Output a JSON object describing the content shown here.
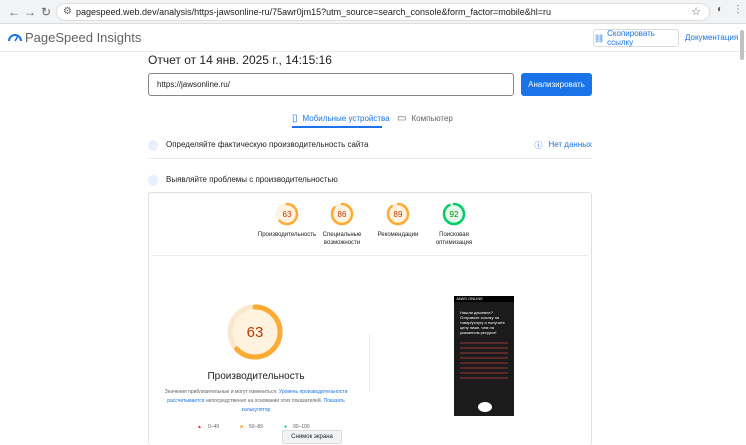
{
  "browser": {
    "url": "pagespeed.web.dev/analysis/https-jawsonline-ru/75awr0jm15?utm_source=search_console&form_factor=mobile&hl=ru"
  },
  "header": {
    "brand": "PageSpeed Insights",
    "copy_link": "Скопировать ссылку",
    "docs": "Документация"
  },
  "report": {
    "title": "Отчет от 14 янв. 2025 г., 14:15:16",
    "input_value": "https://jawsonline.ru/",
    "analyze_label": "Анализировать"
  },
  "tabs": {
    "mobile": "Мобильные устройства",
    "desktop": "Компьютер"
  },
  "sections": {
    "field": "Определяйте фактическую производительность сайта",
    "nodata": "Нет данных",
    "lab": "Выявляйте проблемы с производительностью"
  },
  "scores": [
    {
      "value": "63",
      "label": "Производительность",
      "color": "#fa3",
      "frac": 0.63
    },
    {
      "value": "86",
      "label": "Специальные возможности",
      "color": "#fa3",
      "frac": 0.86
    },
    {
      "value": "89",
      "label": "Рекомендации",
      "color": "#fa3",
      "frac": 0.89
    },
    {
      "value": "92",
      "label": "Поисковая оптимизация",
      "color": "#0c6",
      "frac": 0.92
    }
  ],
  "performance": {
    "score": "63",
    "title": "Производительность",
    "note_a": "Значения приблизительные и могут измениться.",
    "note_link": "Уровень производительности рассчитывается",
    "note_b": "непосредственно на основании этих показателей.",
    "calc_link": "Показать калькулятор"
  },
  "legend": {
    "bad": "0–49",
    "avg": "50–89",
    "good": "90–100"
  },
  "phone": {
    "topbar": "JAWS ONLINE",
    "headline": "Нашли дешевле? Отправьте ссылку на товар/услугу и получите цену ниже, чем на указанном ресурсе!"
  },
  "tooltip": "Снимок экрана",
  "colors": {
    "accent": "#1a73e8",
    "orange": "#fa3",
    "green": "#0c6",
    "red": "#f33"
  }
}
